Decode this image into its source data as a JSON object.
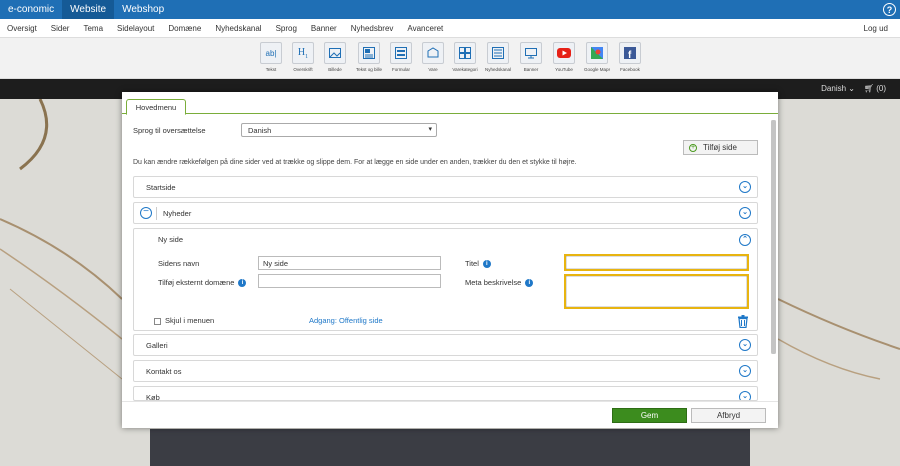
{
  "topbar": {
    "tabs": [
      "e-conomic",
      "Website",
      "Webshop"
    ],
    "help": "?"
  },
  "menu": {
    "items": [
      "Oversigt",
      "Sider",
      "Tema",
      "Sidelayout",
      "Domæne",
      "Nyhedskanal",
      "Sprog",
      "Banner",
      "Nyhedsbrev",
      "Avanceret"
    ],
    "logout": "Log ud"
  },
  "toolbar": {
    "tools": [
      "Tekst",
      "Overskrift",
      "Billede",
      "Tekst og bille...",
      "Formular",
      "Vare",
      "Varekategori",
      "Nyhedskanal",
      "Banner",
      "YouTube",
      "Google Maps",
      "Facebook"
    ]
  },
  "site": {
    "language": "Danish",
    "cart": "(0)"
  },
  "modal": {
    "tab": "Hovedmenu",
    "lang_label": "Sprog til oversættelse",
    "lang_value": "Danish",
    "add_page": "Tilføj side",
    "info": "Du kan ændre rækkefølgen på dine sider ved at trække og slippe dem. For at lægge en side under en anden, trækker du den et stykke til højre.",
    "pages": [
      "Startside",
      "Nyheder",
      "Galleri",
      "Kontakt os",
      "Køb"
    ],
    "new_page": {
      "title": "Ny side",
      "name_label": "Sidens navn",
      "name_value": "Ny side",
      "domain_label": "Tilføj eksternt domæne",
      "title_label": "Titel",
      "meta_label": "Meta beskrivelse",
      "hide_label": "Skjul i menuen",
      "access_label": "Adgang: Offentlig side"
    },
    "save": "Gem",
    "cancel": "Afbryd"
  },
  "colors": {
    "topbar": "#1f6fb5",
    "accent": "#1f78c8",
    "save": "#3c8c1e",
    "highlight": "#e8b410"
  }
}
